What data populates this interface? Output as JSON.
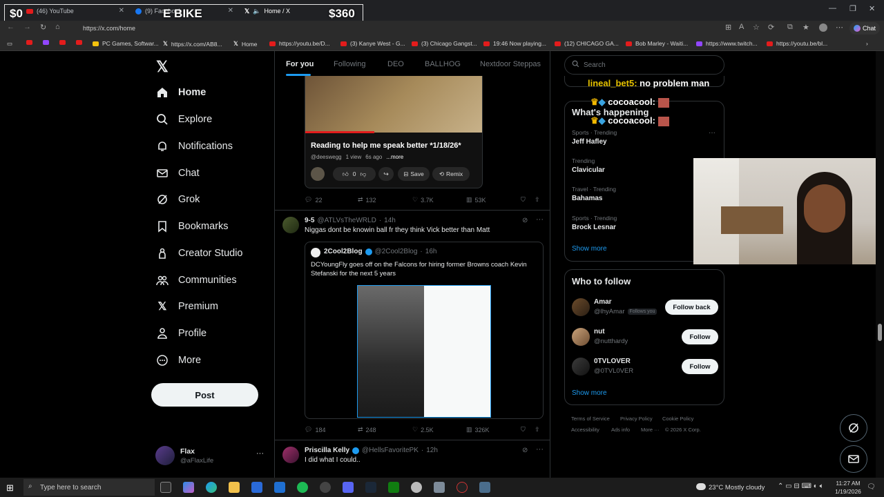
{
  "browser": {
    "tabs": [
      {
        "label": "(46) YouTube"
      },
      {
        "label": "(9) Facebook"
      },
      {
        "label": "Home / X"
      }
    ],
    "url": "https://x.com/home",
    "chat_label": "Chat",
    "bookmarks": [
      {
        "label": ""
      },
      {
        "label": ""
      },
      {
        "label": "PC Games, Softwar..."
      },
      {
        "label": "https://x.com/AB8..."
      },
      {
        "label": "Home"
      },
      {
        "label": "https://youtu.be/D..."
      },
      {
        "label": "(3) Kanye West - G..."
      },
      {
        "label": "(3) Chicago Gangst..."
      },
      {
        "label": "19:46 Now playing..."
      },
      {
        "label": "(12) CHICAGO GA..."
      },
      {
        "label": "Bob Marley - Waiti..."
      },
      {
        "label": "https://www.twitch..."
      },
      {
        "label": "https://youtu.be/bl..."
      }
    ]
  },
  "stream_overlay": {
    "left_amount": "$0",
    "goal_name": "E BIKE",
    "right_amount": "$360",
    "chat": [
      {
        "user": "lineal_bet5:",
        "msg": "no problem man"
      },
      {
        "user": "cocoacool:",
        "msg": ""
      },
      {
        "user": "cocoacool:",
        "msg": ""
      }
    ]
  },
  "nav": {
    "items": [
      {
        "label": "Home",
        "icon": "home-icon"
      },
      {
        "label": "Explore",
        "icon": "search-icon"
      },
      {
        "label": "Notifications",
        "icon": "bell-icon"
      },
      {
        "label": "Chat",
        "icon": "mail-icon"
      },
      {
        "label": "Grok",
        "icon": "grok-icon"
      },
      {
        "label": "Bookmarks",
        "icon": "bookmark-icon"
      },
      {
        "label": "Creator Studio",
        "icon": "creator-icon"
      },
      {
        "label": "Communities",
        "icon": "people-icon"
      },
      {
        "label": "Premium",
        "icon": "x-icon"
      },
      {
        "label": "Profile",
        "icon": "person-icon"
      },
      {
        "label": "More",
        "icon": "more-icon"
      }
    ],
    "post_label": "Post",
    "profile": {
      "name": "Flax",
      "handle": "@aFlaxLife"
    }
  },
  "feed": {
    "tabs": [
      "For you",
      "Following",
      "DEO",
      "BALLHOG",
      "Nextdoor Steppas"
    ],
    "embed_video": {
      "title": "Reading to help me speak better *1/18/26*",
      "channel": "@deeswegg",
      "views": "1 view",
      "age": "6s ago",
      "more": "...more",
      "likes": "0",
      "save": "Save",
      "remix": "Remix"
    },
    "post1_metrics": {
      "replies": "22",
      "reposts": "132",
      "likes": "3.7K",
      "views": "53K"
    },
    "post2": {
      "name": "9-5",
      "handle": "@ATLVsTheWRLD",
      "time": "14h",
      "text": "Niggas dont be knowin ball fr they think Vick better than Matt",
      "quote": {
        "name": "2Cool2Blog",
        "handle": "@2Cool2Blog",
        "time": "16h",
        "text": "DCYoungFly goes off on the Falcons for hiring former Browns coach Kevin Stefanski for the next 5 years"
      },
      "metrics": {
        "replies": "184",
        "reposts": "248",
        "likes": "2.5K",
        "views": "326K"
      }
    },
    "post3": {
      "name": "Priscilla Kelly",
      "handle": "@HellsFavoritePK",
      "time": "12h",
      "text": "I did what I could.."
    }
  },
  "right": {
    "search_placeholder": "Search",
    "happening_title": "What's happening",
    "trends": [
      {
        "meta": "Sports · Trending",
        "name": "Jeff Hafley"
      },
      {
        "meta": "Trending",
        "name": "Clavicular"
      },
      {
        "meta": "Travel · Trending",
        "name": "Bahamas"
      },
      {
        "meta": "Sports · Trending",
        "name": "Brock Lesnar"
      }
    ],
    "show_more": "Show more",
    "wtf_title": "Who to follow",
    "follow": [
      {
        "name": "Amar",
        "handle": "@lhyAmar",
        "badge": "Follows you",
        "button": "Follow back"
      },
      {
        "name": "nut",
        "handle": "@nutthardy",
        "badge": "",
        "button": "Follow"
      },
      {
        "name": "0TVLOVER",
        "handle": "@0TVL0VER",
        "badge": "",
        "button": "Follow"
      }
    ],
    "footer": [
      "Terms of Service",
      "Privacy Policy",
      "Cookie Policy",
      "Accessibility",
      "Ads info",
      "More ···",
      "© 2026 X Corp."
    ]
  },
  "taskbar": {
    "search_placeholder": "Type here to search",
    "weather": "23°C  Mostly cloudy",
    "time": "11:27 AM",
    "date": "1/19/2026"
  }
}
